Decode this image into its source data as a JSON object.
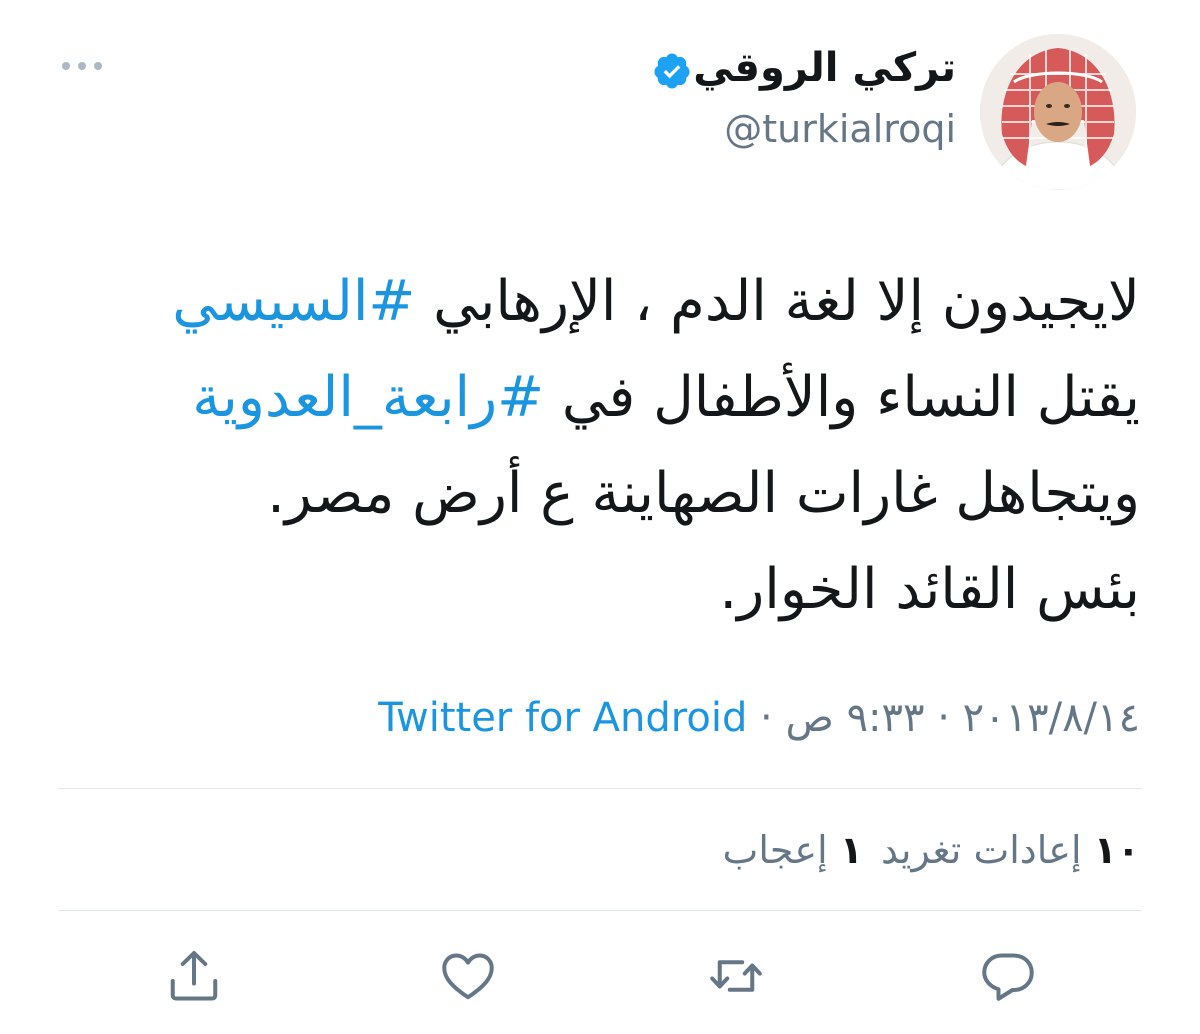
{
  "user": {
    "display_name": "تركي الروقي",
    "username": "@turkialroqi",
    "verified": true,
    "avatar_icon": "profile-photo"
  },
  "header": {
    "more_icon": "more-horizontal-icon"
  },
  "tweet": {
    "line1_text": "لايجيدون إلا لغة الدم ، الإرهابي ",
    "line1_hashtag": "#السيسي",
    "line2_text": "يقتل النساء والأطفال في ",
    "line2_hashtag": "#رابعة_العدوية",
    "line3_text": "ويتجاهل غارات الصهاينة ع أرض مصر.",
    "line4_text": "بئس القائد الخوار."
  },
  "meta": {
    "date": "٢٠١٣/٨/١٤",
    "separator": " · ",
    "time": "٩:٣٣ ص",
    "source": "Twitter for Android"
  },
  "stats": {
    "retweets_count": "١٠",
    "retweets_label": "إعادات تغريد",
    "likes_count": "١",
    "likes_label": "إعجاب"
  },
  "actions": {
    "reply_icon": "reply-icon",
    "retweet_icon": "retweet-icon",
    "like_icon": "heart-icon",
    "share_icon": "share-icon"
  },
  "colors": {
    "link": "#1b95e0",
    "secondary_text": "#657786",
    "divider": "#e1e8ed",
    "verified_badge": "#1da1f2"
  }
}
